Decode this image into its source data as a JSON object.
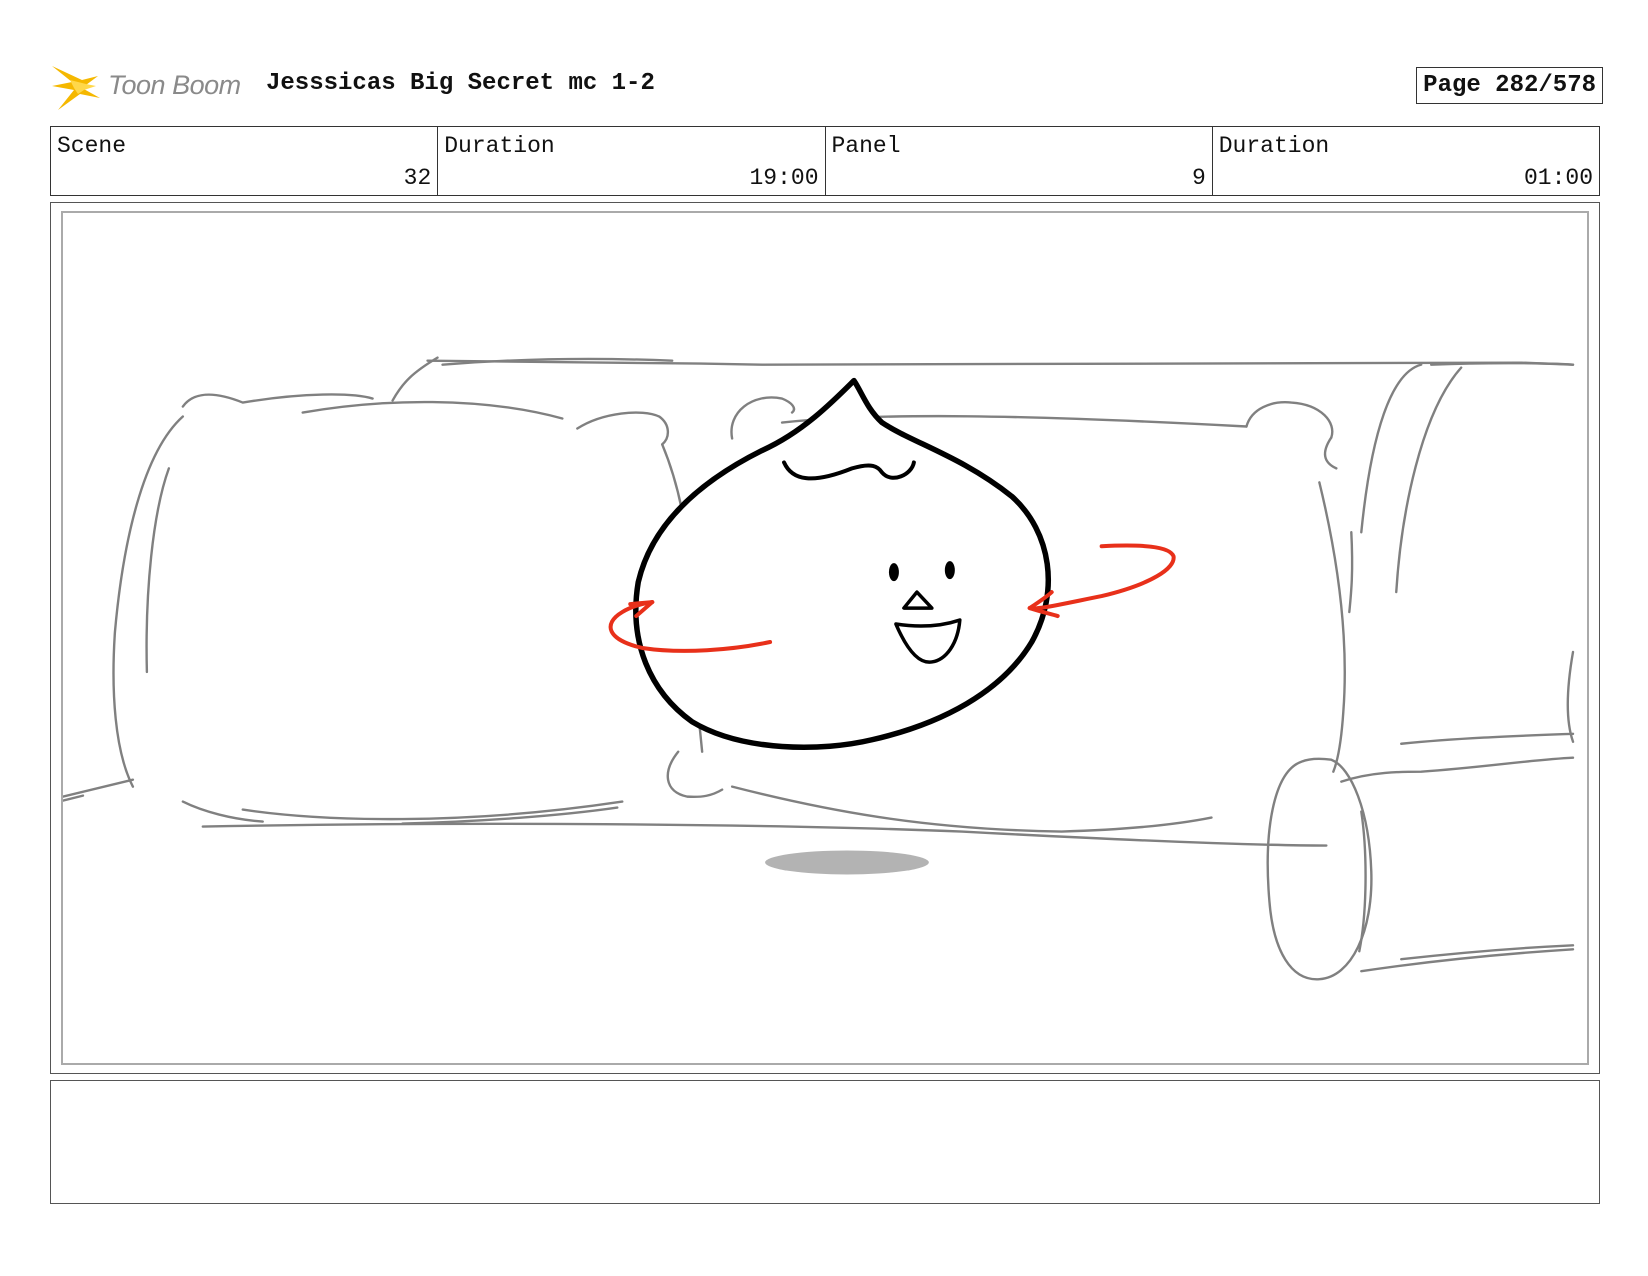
{
  "header": {
    "logo_text": "Toon Boom",
    "title": "Jesssicas Big Secret mc 1-2",
    "page": "Page 282/578"
  },
  "info": {
    "scene_label": "Scene",
    "scene_value": "32",
    "scene_duration_label": "Duration",
    "scene_duration_value": "19:00",
    "panel_label": "Panel",
    "panel_value": "9",
    "panel_duration_label": "Duration",
    "panel_duration_value": "01:00"
  },
  "notes": {
    "text": ""
  },
  "colors": {
    "sketch_gray": "#808080",
    "ink_black": "#000000",
    "motion_red": "#e8301a",
    "logo_yellow": "#f5b800"
  }
}
